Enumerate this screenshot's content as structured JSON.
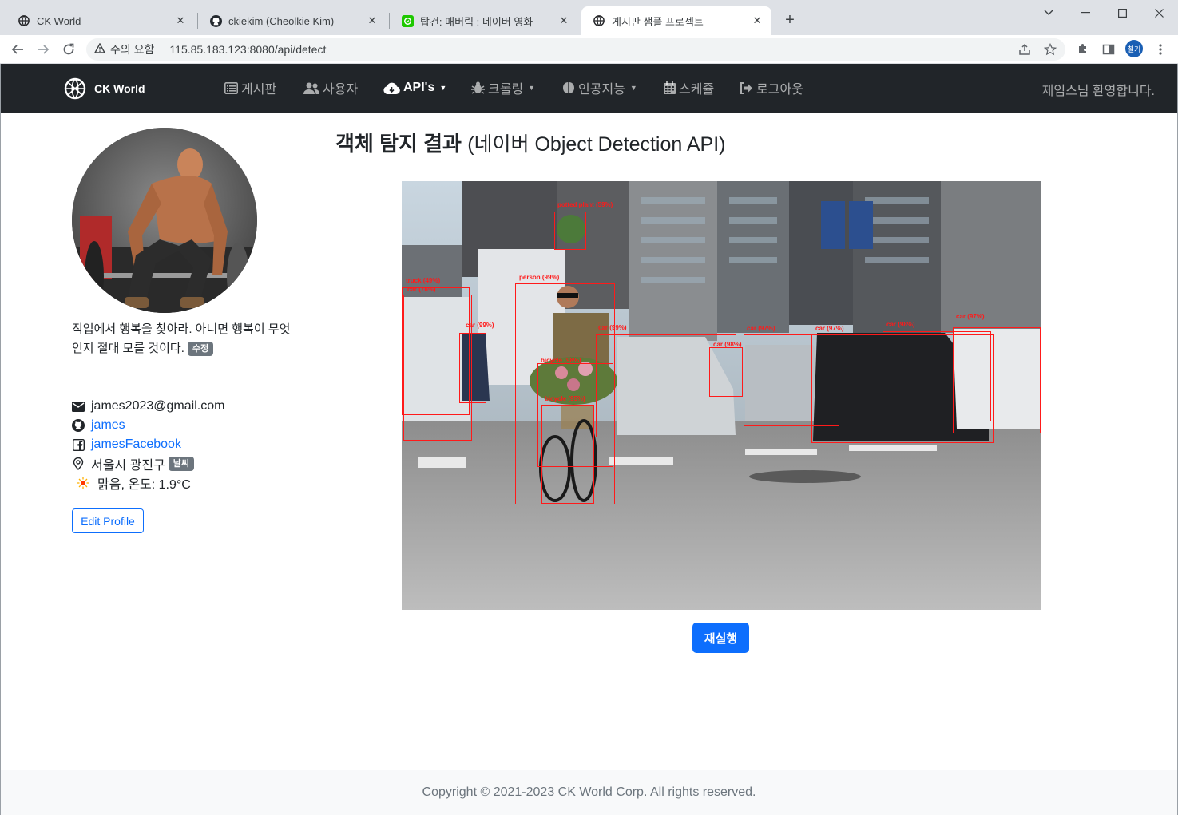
{
  "browser": {
    "tabs": [
      {
        "title": "CK World",
        "icon": "globe-icon"
      },
      {
        "title": "ckiekim (Cheolkie Kim)",
        "icon": "github-icon"
      },
      {
        "title": "탑건: 매버릭 : 네이버 영화",
        "icon": "naver-icon"
      },
      {
        "title": "게시판 샘플 프로젝트",
        "icon": "globe-icon"
      }
    ],
    "security_label": "주의 요함",
    "url": "115.85.183.123:8080/api/detect",
    "profile_initials": "철기"
  },
  "navbar": {
    "brand": "CK World",
    "items": [
      {
        "label": "게시판",
        "icon": "list-icon",
        "dropdown": false,
        "active": false
      },
      {
        "label": "사용자",
        "icon": "users-icon",
        "dropdown": false,
        "active": false
      },
      {
        "label": "API's",
        "icon": "cloud-download-icon",
        "dropdown": true,
        "active": true
      },
      {
        "label": "크롤링",
        "icon": "bug-icon",
        "dropdown": true,
        "active": false
      },
      {
        "label": "인공지능",
        "icon": "brain-icon",
        "dropdown": true,
        "active": false
      },
      {
        "label": "스케쥴",
        "icon": "calendar-icon",
        "dropdown": false,
        "active": false
      },
      {
        "label": "로그아웃",
        "icon": "sign-out-icon",
        "dropdown": false,
        "active": false
      }
    ],
    "welcome": "제임스님 환영합니다."
  },
  "profile": {
    "bio_line1": "직업에서 행복을 찾아라. 아니면 행복이 무엇",
    "bio_line2": "인지 절대 모를 것이다.",
    "edit_badge": "수정",
    "email": "james2023@gmail.com",
    "github": "james",
    "facebook": "jamesFacebook",
    "address": "서울시 광진구",
    "weather_badge": "날씨",
    "weather": "맑음, 온도: 1.9°C",
    "edit_button": "Edit Profile"
  },
  "main": {
    "title": "객체 탐지 결과",
    "subtitle": "(네이버 Object Detection API)",
    "rerun_button": "재실행",
    "detections": [
      {
        "label": "potted plant (59%)"
      },
      {
        "label": "truck (49%)"
      },
      {
        "label": "car (76%)"
      },
      {
        "label": "person (99%)"
      },
      {
        "label": "car (99%)"
      },
      {
        "label": "car (99%)"
      },
      {
        "label": "car (98%)"
      },
      {
        "label": "car (97%)"
      },
      {
        "label": "car (97%)"
      },
      {
        "label": "car (98%)"
      },
      {
        "label": "car (97%)"
      },
      {
        "label": "bicycle (98%)"
      },
      {
        "label": "bicycle (95%)"
      }
    ]
  },
  "footer": {
    "copyright": "Copyright © 2021-2023 CK World Corp. All rights reserved."
  }
}
